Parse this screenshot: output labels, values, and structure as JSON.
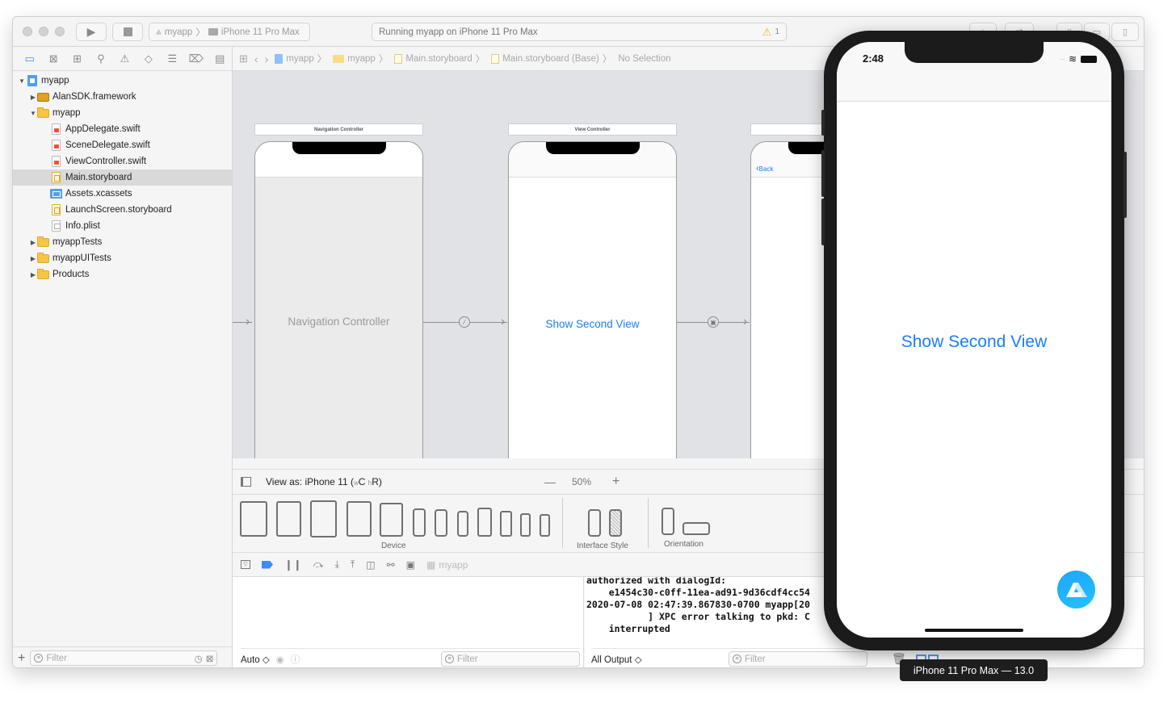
{
  "toolbar": {
    "scheme_target": "myapp",
    "scheme_device": "iPhone 11 Pro Max",
    "activity_text": "Running myapp on iPhone 11 Pro Max",
    "warning_count": "1"
  },
  "navigator": {
    "tabs": [
      "project-navigator",
      "source-control-navigator",
      "symbol-navigator",
      "find-navigator",
      "issue-navigator",
      "test-navigator",
      "debug-navigator",
      "breakpoint-navigator",
      "report-navigator"
    ],
    "tree": [
      {
        "label": "myapp",
        "type": "project",
        "depth": 0,
        "expanded": true
      },
      {
        "label": "AlanSDK.framework",
        "type": "framework",
        "depth": 1,
        "expanded": false
      },
      {
        "label": "myapp",
        "type": "folder",
        "depth": 1,
        "expanded": true
      },
      {
        "label": "AppDelegate.swift",
        "type": "swift",
        "depth": 2
      },
      {
        "label": "SceneDelegate.swift",
        "type": "swift",
        "depth": 2
      },
      {
        "label": "ViewController.swift",
        "type": "swift",
        "depth": 2
      },
      {
        "label": "Main.storyboard",
        "type": "storyboard",
        "depth": 2,
        "selected": true
      },
      {
        "label": "Assets.xcassets",
        "type": "assets",
        "depth": 2
      },
      {
        "label": "LaunchScreen.storyboard",
        "type": "storyboard",
        "depth": 2
      },
      {
        "label": "Info.plist",
        "type": "plist",
        "depth": 2
      },
      {
        "label": "myappTests",
        "type": "folder",
        "depth": 1,
        "expanded": false
      },
      {
        "label": "myappUITests",
        "type": "folder",
        "depth": 1,
        "expanded": false
      },
      {
        "label": "Products",
        "type": "folder",
        "depth": 1,
        "expanded": false
      }
    ],
    "filter_placeholder": "Filter"
  },
  "jumpbar": {
    "crumbs": [
      "myapp",
      "myapp",
      "Main.storyboard",
      "Main.storyboard (Base)",
      "No Selection"
    ]
  },
  "storyboard": {
    "scene1_title": "Navigation Controller",
    "scene1_label": "Navigation Controller",
    "scene2_title": "View Controller",
    "scene2_button": "Show Second View",
    "scene3_back": "Back"
  },
  "config": {
    "view_as": "View as: iPhone 11 (",
    "size_class_w": "w",
    "size_class_wv": "C",
    "size_class_h": "h",
    "size_class_hv": "R)",
    "zoom_minus": "—",
    "zoom_level": "50%",
    "zoom_plus": "+",
    "device_label": "Device",
    "interface_style_label": "Interface Style",
    "orientation_label": "Orientation"
  },
  "debug": {
    "process": "myapp",
    "console_lines": [
      "authorized with dialogId:",
      "    e1454c30-c0ff-11ea-ad91-9d36cdf4cc54",
      "2020-07-08 02:47:39.867830-0700 myapp[20",
      "           ] XPC error talking to pkd: C",
      "    interrupted"
    ],
    "auto_label": "Auto ◇",
    "output_label": "All Output ◇",
    "filter_placeholder": "Filter"
  },
  "simulator": {
    "time": "2:48",
    "button_label": "Show Second View",
    "tooltip": "iPhone 11 Pro Max — 13.0",
    "accent": "#1a7ef5"
  }
}
